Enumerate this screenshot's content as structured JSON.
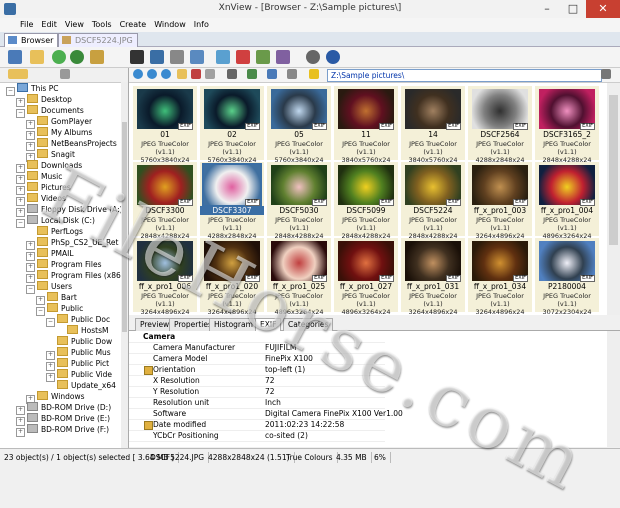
{
  "window": {
    "title": "XnView - [Browser - Z:\\Sample pictures\\]",
    "min": "–",
    "max": "□",
    "close": "✕"
  },
  "menu": [
    "File",
    "Edit",
    "View",
    "Tools",
    "Create",
    "Window",
    "Info"
  ],
  "tabs": [
    {
      "label": "Browser"
    },
    {
      "label": "DSCF5224.JPG"
    }
  ],
  "path": "Z:\\Sample pictures\\",
  "tree": [
    {
      "label": "This PC",
      "depth": 0,
      "kind": "pc",
      "exp": "−"
    },
    {
      "label": "Desktop",
      "depth": 1,
      "kind": "folder",
      "exp": "+"
    },
    {
      "label": "Documents",
      "depth": 1,
      "kind": "folder",
      "exp": "−"
    },
    {
      "label": "GomPlayer",
      "depth": 2,
      "kind": "folder",
      "exp": "+"
    },
    {
      "label": "My Albums",
      "depth": 2,
      "kind": "folder",
      "exp": "+"
    },
    {
      "label": "NetBeansProjects",
      "depth": 2,
      "kind": "folder",
      "exp": "+"
    },
    {
      "label": "Snagit",
      "depth": 2,
      "kind": "folder",
      "exp": "+"
    },
    {
      "label": "Downloads",
      "depth": 1,
      "kind": "folder",
      "exp": "+"
    },
    {
      "label": "Music",
      "depth": 1,
      "kind": "folder",
      "exp": "+"
    },
    {
      "label": "Pictures",
      "depth": 1,
      "kind": "folder",
      "exp": "+"
    },
    {
      "label": "Videos",
      "depth": 1,
      "kind": "folder",
      "exp": "+"
    },
    {
      "label": "Floppy Disk Drive (A:)",
      "depth": 1,
      "kind": "drive",
      "exp": "+"
    },
    {
      "label": "Local Disk (C:)",
      "depth": 1,
      "kind": "drive",
      "exp": "−"
    },
    {
      "label": "PerfLogs",
      "depth": 2,
      "kind": "folder",
      "exp": ""
    },
    {
      "label": "PhSp_CS2_UE_Ret",
      "depth": 2,
      "kind": "folder",
      "exp": "+"
    },
    {
      "label": "PMAIL",
      "depth": 2,
      "kind": "folder",
      "exp": "+"
    },
    {
      "label": "Program Files",
      "depth": 2,
      "kind": "folder",
      "exp": "+"
    },
    {
      "label": "Program Files (x86",
      "depth": 2,
      "kind": "folder",
      "exp": "+"
    },
    {
      "label": "Users",
      "depth": 2,
      "kind": "folder",
      "exp": "−"
    },
    {
      "label": "Bart",
      "depth": 3,
      "kind": "folder",
      "exp": "+"
    },
    {
      "label": "Public",
      "depth": 3,
      "kind": "folder",
      "exp": "−"
    },
    {
      "label": "Public Doc",
      "depth": 4,
      "kind": "folder",
      "exp": "−"
    },
    {
      "label": "HostsM",
      "depth": 5,
      "kind": "folder",
      "exp": ""
    },
    {
      "label": "Public Dow",
      "depth": 4,
      "kind": "folder",
      "exp": ""
    },
    {
      "label": "Public Mus",
      "depth": 4,
      "kind": "folder",
      "exp": "+"
    },
    {
      "label": "Public Pict",
      "depth": 4,
      "kind": "folder",
      "exp": "+"
    },
    {
      "label": "Public Vide",
      "depth": 4,
      "kind": "folder",
      "exp": "+"
    },
    {
      "label": "Update_x64",
      "depth": 4,
      "kind": "folder",
      "exp": ""
    },
    {
      "label": "Windows",
      "depth": 2,
      "kind": "folder",
      "exp": "+"
    },
    {
      "label": "BD-ROM Drive (D:)",
      "depth": 1,
      "kind": "drive",
      "exp": "+"
    },
    {
      "label": "BD-ROM Drive (E:)",
      "depth": 1,
      "kind": "drive",
      "exp": "+"
    },
    {
      "label": "BD-ROM Drive (F:)",
      "depth": 1,
      "kind": "drive",
      "exp": "+"
    }
  ],
  "thumbs": [
    {
      "name": "01",
      "info": "JPEG TrueColor (v1.1)",
      "dims": "5760x3840x24",
      "colors": [
        "#1a3a4a",
        "#3fbf7a",
        "#0a1a2a"
      ],
      "exif": "EXIF"
    },
    {
      "name": "02",
      "info": "JPEG TrueColor (v1.1)",
      "dims": "5760x3840x24",
      "colors": [
        "#1e4a5a",
        "#5ad08a",
        "#0a1a2a"
      ],
      "exif": "EXIF"
    },
    {
      "name": "05",
      "info": "JPEG TrueColor (v1.1)",
      "dims": "5760x3840x24",
      "colors": [
        "#3a6a9a",
        "#c0d8ef",
        "#2a3a4a"
      ],
      "exif": "EXIF"
    },
    {
      "name": "11",
      "info": "JPEG TrueColor (v1.1)",
      "dims": "3840x5760x24",
      "colors": [
        "#2a1a10",
        "#c07030",
        "#601020"
      ],
      "exif": "EXIF"
    },
    {
      "name": "14",
      "info": "JPEG TrueColor (v1.1)",
      "dims": "3840x5760x24",
      "colors": [
        "#2a2a2a",
        "#a08060",
        "#403020"
      ],
      "exif": "EXIF"
    },
    {
      "name": "DSCF2564",
      "info": "JPEG TrueColor (v1.1)",
      "dims": "4288x2848x24",
      "colors": [
        "#e0e0e0",
        "#303030",
        "#808080"
      ],
      "exif": "EXIF"
    },
    {
      "name": "DSCF3165_2",
      "info": "JPEG TrueColor (v1.1)",
      "dims": "2848x4288x24",
      "colors": [
        "#c02060",
        "#f090c0",
        "#501030"
      ],
      "exif": "EXIF"
    },
    {
      "name": "DSCF3300",
      "info": "JPEG TrueColor (v1.1)",
      "dims": "2848x4288x24",
      "colors": [
        "#305020",
        "#e0a020",
        "#a02020"
      ],
      "exif": "EXIF"
    },
    {
      "name": "DSCF3307",
      "info": "JPEG TrueColor (v1.1)",
      "dims": "4288x2848x24",
      "colors": [
        "#4070a0",
        "#e060a0",
        "#f0f0f0"
      ],
      "exif": "EXIF"
    },
    {
      "name": "DSCF5030",
      "info": "JPEG TrueColor (v1.1)",
      "dims": "2848x4288x24",
      "colors": [
        "#204018",
        "#f0c0c0",
        "#608030"
      ],
      "exif": "EXIF"
    },
    {
      "name": "DSCF5099",
      "info": "JPEG TrueColor (v1.1)",
      "dims": "2848x4288x24",
      "colors": [
        "#203010",
        "#f0d020",
        "#508020"
      ],
      "exif": "EXIF"
    },
    {
      "name": "DSCF5224",
      "info": "JPEG TrueColor (v1.1)",
      "dims": "2848x4288x24",
      "colors": [
        "#304020",
        "#e8c030",
        "#806020"
      ],
      "exif": "EXIF"
    },
    {
      "name": "ff_x_pro1_003",
      "info": "JPEG TrueColor (v1.1)",
      "dims": "3264x4896x24",
      "colors": [
        "#2a2010",
        "#c09050",
        "#604020"
      ],
      "exif": "EXIF"
    },
    {
      "name": "ff_x_pro1_004",
      "info": "JPEG TrueColor (v1.1)",
      "dims": "4896x3264x24",
      "colors": [
        "#102040",
        "#f0d020",
        "#c02030"
      ],
      "exif": "EXIF"
    },
    {
      "name": "ff_x_pro1_006",
      "info": "JPEG TrueColor (v1.1)",
      "dims": "3264x4896x24",
      "colors": [
        "#203040",
        "#a0c0e0",
        "#304020"
      ],
      "exif": "EXIF"
    },
    {
      "name": "ff_x_pro1_020",
      "info": "JPEG TrueColor (v1.1)",
      "dims": "3264x4896x24",
      "colors": [
        "#201008",
        "#d0a040",
        "#503010"
      ],
      "exif": "EXIF"
    },
    {
      "name": "ff_x_pro1_025",
      "info": "JPEG TrueColor (v1.1)",
      "dims": "4896x3264x24",
      "colors": [
        "#2a0a0a",
        "#c04040",
        "#f0d0c0"
      ],
      "exif": "EXIF"
    },
    {
      "name": "ff_x_pro1_027",
      "info": "JPEG TrueColor (v1.1)",
      "dims": "4896x3264x24",
      "colors": [
        "#3a1008",
        "#e07040",
        "#701010"
      ],
      "exif": "EXIF"
    },
    {
      "name": "ff_x_pro1_031",
      "info": "JPEG TrueColor (v1.1)",
      "dims": "3264x4896x24",
      "colors": [
        "#1a1008",
        "#c09060",
        "#403020"
      ],
      "exif": "EXIF"
    },
    {
      "name": "ff_x_pro1_034",
      "info": "JPEG TrueColor (v1.1)",
      "dims": "3264x4896x24",
      "colors": [
        "#2a1a08",
        "#d09030",
        "#603010"
      ],
      "exif": "EXIF"
    },
    {
      "name": "P2180004",
      "info": "JPEG TrueColor (v1.1)",
      "dims": "3072x2304x24",
      "colors": [
        "#5080c0",
        "#f0f0f8",
        "#304050"
      ],
      "exif": "EXIF"
    }
  ],
  "selectedIndex": 8,
  "infoTabs": [
    "Preview",
    "Properties",
    "Histogram",
    "EXIF",
    "Categories"
  ],
  "activeInfoTab": 3,
  "exif": [
    {
      "k": "Camera",
      "v": "",
      "hdr": true
    },
    {
      "k": "Camera Manufacturer",
      "v": "FUJIFILM"
    },
    {
      "k": "Camera Model",
      "v": "FinePix X100"
    },
    {
      "k": "Orientation",
      "v": "top-left (1)",
      "pen": true
    },
    {
      "k": "X Resolution",
      "v": "72"
    },
    {
      "k": "Y Resolution",
      "v": "72"
    },
    {
      "k": "Resolution unit",
      "v": "Inch"
    },
    {
      "k": "Software",
      "v": "Digital Camera FinePix X100 Ver1.00"
    },
    {
      "k": "Date modified",
      "v": "2011:02:23 14:22:58",
      "pen": true
    },
    {
      "k": "YCbCr Positioning",
      "v": "co-sited (2)"
    }
  ],
  "status": [
    "23 object(s) / 1 object(s) selected  [ 3.64 MB ]",
    "DSCF5224.JPG",
    "4288x2848x24 (1.51)",
    "True Colours",
    "4.35 MB",
    "6%"
  ],
  "watermark": "FileHorse.com"
}
